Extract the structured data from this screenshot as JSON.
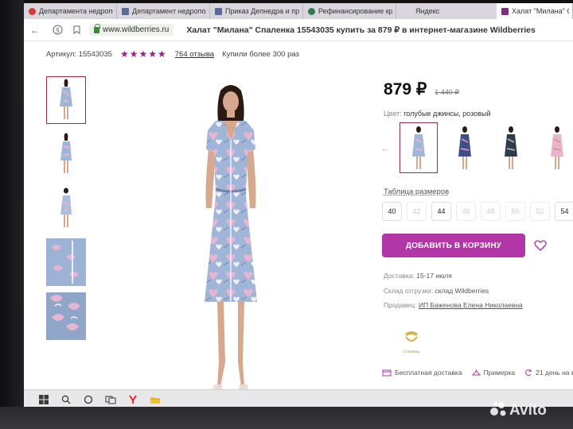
{
  "browser": {
    "tabs": [
      {
        "label": "Департамента недрополь",
        "color": "#d23b3b"
      },
      {
        "label": "Департамент недропольз",
        "color": "#5a6b9a"
      },
      {
        "label": "Приказ Депнедра и прир",
        "color": "#5a6b9a"
      },
      {
        "label": "Рефинансирование кред",
        "color": "#2f7d4a"
      },
      {
        "label": "Яндекс",
        "color": ""
      },
      {
        "label": "Халат \"Милана\" С",
        "color": "#7a2f7a"
      }
    ],
    "url": "www.wildberries.ru",
    "page_title": "Халат \"Милана\" Спаленка 15543035 купить за 879 ₽ в интернет-магазине Wildberries"
  },
  "product": {
    "article": "Артикул: 15543035",
    "stars_display": "★★★★★",
    "rating": 5,
    "reviews": "764 отзыва",
    "bought": "Купили более 300 раз",
    "price": "879 ₽",
    "old_price": "1 440 ₽",
    "color_label": "Цвет:",
    "color_value": "голубые джинсы, розовый",
    "size_table": "Таблица размеров",
    "sizes": [
      {
        "label": "40",
        "available": true
      },
      {
        "label": "42",
        "available": false
      },
      {
        "label": "44",
        "available": true
      },
      {
        "label": "46",
        "available": false
      },
      {
        "label": "48",
        "available": false
      },
      {
        "label": "50",
        "available": false
      },
      {
        "label": "52",
        "available": false
      },
      {
        "label": "54",
        "available": true
      }
    ],
    "add_to_cart": "ДОБАВИТЬ В КОРЗИНУ",
    "delivery_label": "Доставка:",
    "delivery_value": "15-17 июля",
    "warehouse_label": "Склад отгрузки:",
    "warehouse_value": "склад Wildberries",
    "seller_label": "Продавец:",
    "seller_value": "ИП Баженова Елена Николаевна",
    "brand_name": "Спаленка",
    "perks": [
      "Бесплатная доставка",
      "Примерка",
      "21 день на в"
    ]
  },
  "colors": {
    "accent": "#b236a6",
    "stars": "#9e1b8e",
    "dress_blue": "#9fb6d8",
    "dress_pink": "#e7b4d2"
  },
  "watermark": "Avito"
}
